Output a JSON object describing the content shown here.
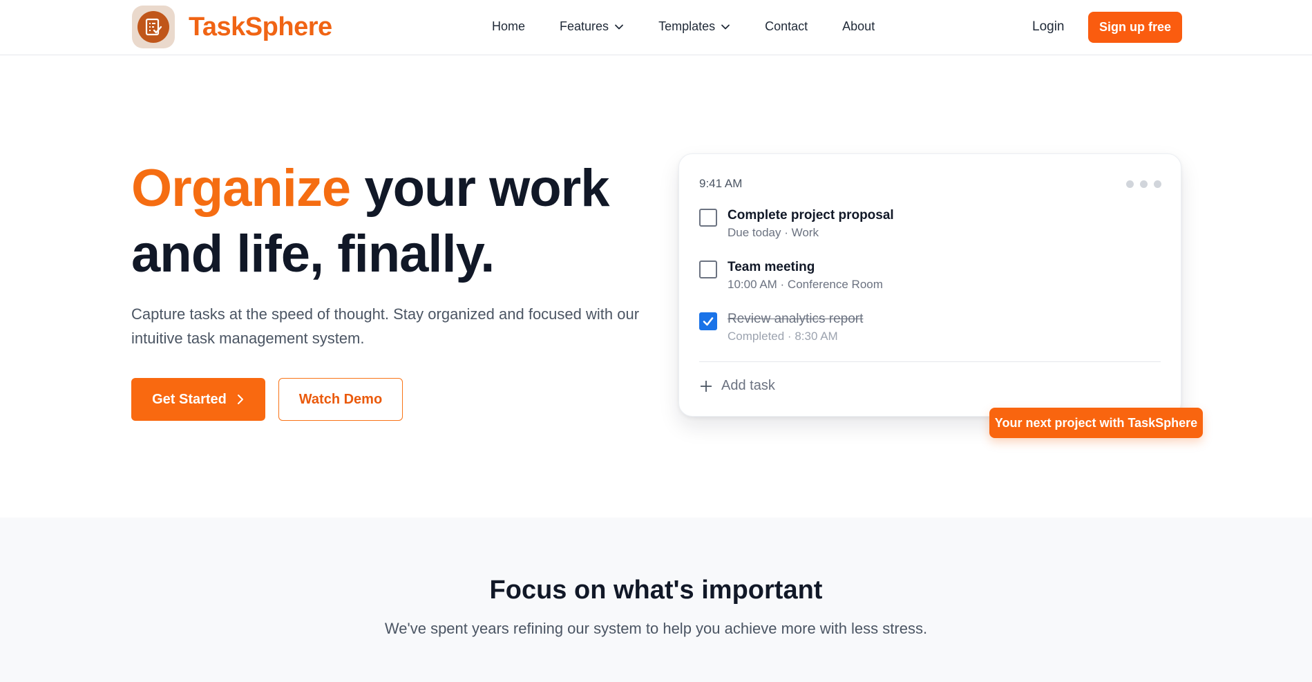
{
  "brand": {
    "name": "TaskSphere",
    "accent_color": "#f97316",
    "logo_icon": "checklist-icon"
  },
  "nav": {
    "items": [
      {
        "label": "Home",
        "has_dropdown": false
      },
      {
        "label": "Features",
        "has_dropdown": true
      },
      {
        "label": "Templates",
        "has_dropdown": true
      },
      {
        "label": "Contact",
        "has_dropdown": false
      },
      {
        "label": "About",
        "has_dropdown": false
      }
    ],
    "login_label": "Login",
    "signup_label": "Sign up free"
  },
  "hero": {
    "title_accent": "Organize",
    "title_line1_rest": " your work",
    "title_line2": "and life, finally.",
    "subtitle": "Capture tasks at the speed of thought. Stay organized and focused with our intuitive task management system.",
    "primary_cta": "Get Started",
    "secondary_cta": "Watch Demo"
  },
  "task_card": {
    "time": "9:41 AM",
    "tasks": [
      {
        "title": "Complete project proposal",
        "meta": "Due today · Work",
        "completed": false
      },
      {
        "title": "Team meeting",
        "meta": "10:00 AM · Conference Room",
        "completed": false
      },
      {
        "title": "Review analytics report",
        "meta": "Completed · 8:30 AM",
        "completed": true
      }
    ],
    "add_task_label": "Add task",
    "badge": "Your next project with TaskSphere"
  },
  "section2": {
    "title": "Focus on what's important",
    "subtitle": "We've spent years refining our system to help you achieve more with less stress."
  }
}
